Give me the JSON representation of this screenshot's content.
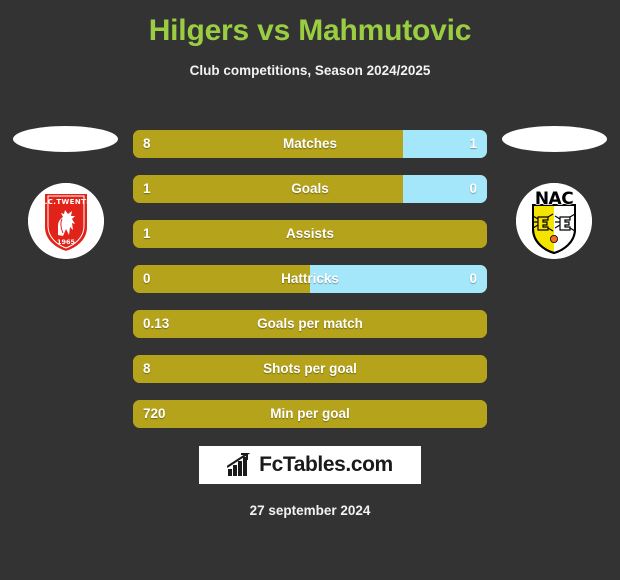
{
  "header": {
    "title": "Hilgers vs Mahmutovic",
    "subtitle": "Club competitions, Season 2024/2025",
    "title_color": "#9ACD42"
  },
  "teams": {
    "home": {
      "crest_name": "fc-twente-crest",
      "crest_top_text": "F.C.TWENTE",
      "crest_bottom_text": "1965",
      "crest_colors": {
        "primary": "#e2231a",
        "secondary": "#ffffff"
      }
    },
    "away": {
      "crest_name": "nac-breda-crest",
      "crest_top_text": "NAC",
      "crest_colors": {
        "primary": "#f5e400",
        "secondary": "#000000"
      }
    }
  },
  "colors": {
    "background": "#333333",
    "home_bar": "#B5A31C",
    "away_bar": "#A5E7FA",
    "bar_text": "#ffffff"
  },
  "stats": [
    {
      "label": "Matches",
      "home": "8",
      "away": "1",
      "home_pct": 76.3,
      "show_away": true
    },
    {
      "label": "Goals",
      "home": "1",
      "away": "0",
      "home_pct": 76.3,
      "show_away": true
    },
    {
      "label": "Assists",
      "home": "1",
      "away": "",
      "home_pct": 100,
      "show_away": false
    },
    {
      "label": "Hattricks",
      "home": "0",
      "away": "0",
      "home_pct": 50,
      "show_away": true
    },
    {
      "label": "Goals per match",
      "home": "0.13",
      "away": "",
      "home_pct": 100,
      "show_away": false
    },
    {
      "label": "Shots per goal",
      "home": "8",
      "away": "",
      "home_pct": 100,
      "show_away": false
    },
    {
      "label": "Min per goal",
      "home": "720",
      "away": "",
      "home_pct": 100,
      "show_away": false
    }
  ],
  "footer": {
    "logo_text": "FcTables.com",
    "logo_icon": "bar-chart-growth-icon",
    "date": "27 september 2024"
  }
}
